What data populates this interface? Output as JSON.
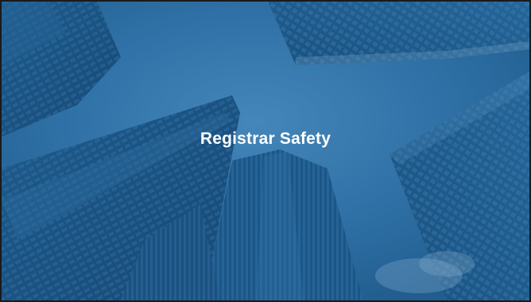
{
  "slide": {
    "title": "Registrar Safety"
  },
  "colors": {
    "sky": "#2f6f9e",
    "sky_light": "#4f93c4",
    "building_dark": "#123f66",
    "building_mid": "#1d5585",
    "title_text": "#ffffff"
  },
  "background": {
    "image_subject": "skyscrapers-from-below"
  }
}
